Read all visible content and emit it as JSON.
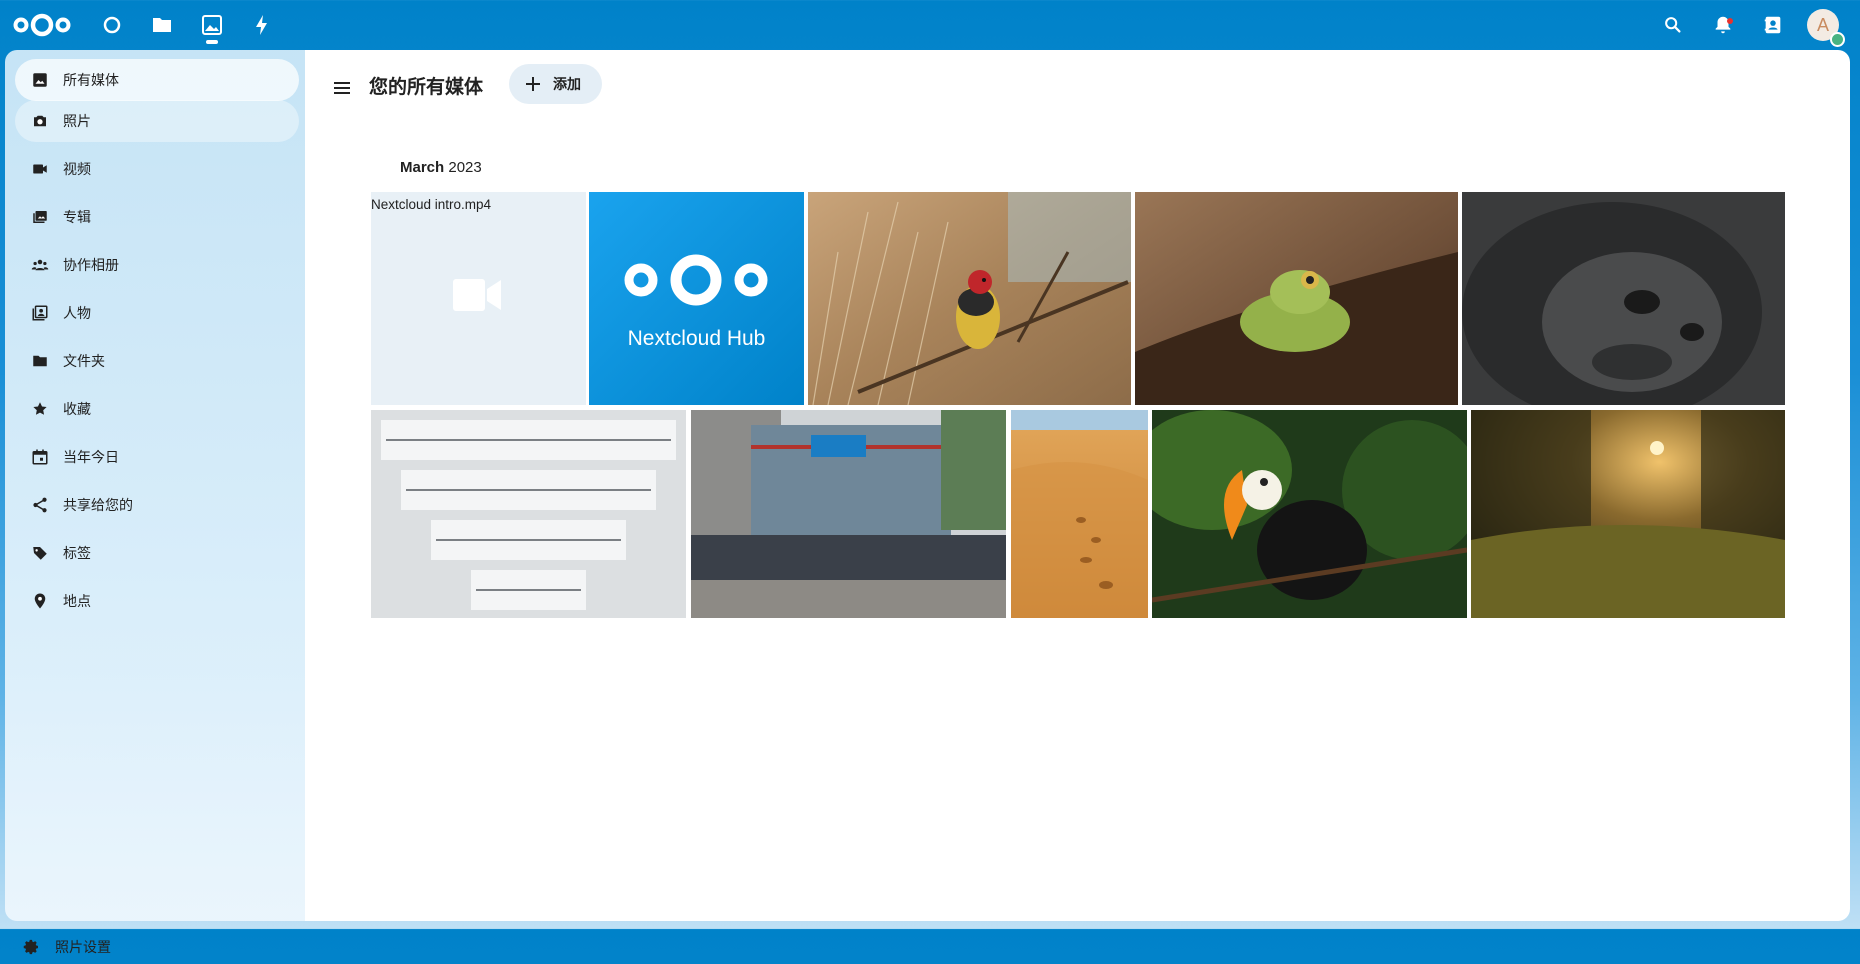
{
  "topbar": {
    "apps": [
      {
        "name": "dashboard",
        "icon": "circle-icon"
      },
      {
        "name": "files",
        "icon": "folder-icon"
      },
      {
        "name": "photos",
        "icon": "image-icon",
        "active": true
      },
      {
        "name": "activity",
        "icon": "bolt-icon"
      }
    ],
    "right_icons": [
      "search-icon",
      "bell-icon",
      "contacts-icon"
    ],
    "avatar_initial": "A"
  },
  "sidebar": {
    "items": [
      {
        "label": "所有媒体",
        "icon": "image-icon",
        "state": "active"
      },
      {
        "label": "照片",
        "icon": "camera-icon",
        "state": "hover"
      },
      {
        "label": "视频",
        "icon": "video-icon"
      },
      {
        "label": "专辑",
        "icon": "album-icon"
      },
      {
        "label": "协作相册",
        "icon": "people-icon"
      },
      {
        "label": "人物",
        "icon": "person-icon"
      },
      {
        "label": "文件夹",
        "icon": "folder-icon"
      },
      {
        "label": "收藏",
        "icon": "star-icon"
      },
      {
        "label": "当年今日",
        "icon": "calendar-icon"
      },
      {
        "label": "共享给您的",
        "icon": "share-icon"
      },
      {
        "label": "标签",
        "icon": "tag-icon"
      },
      {
        "label": "地点",
        "icon": "map-marker-icon"
      }
    ],
    "settings_label": "照片设置"
  },
  "main": {
    "title": "您的所有媒体",
    "add_label": "添加",
    "section_month": "March",
    "section_year": "2023",
    "video_name": "Nextcloud intro.mp4",
    "hub_text": "Nextcloud Hub"
  },
  "colors": {
    "brand": "#0082c9",
    "accent_light": "#e4eef6"
  }
}
